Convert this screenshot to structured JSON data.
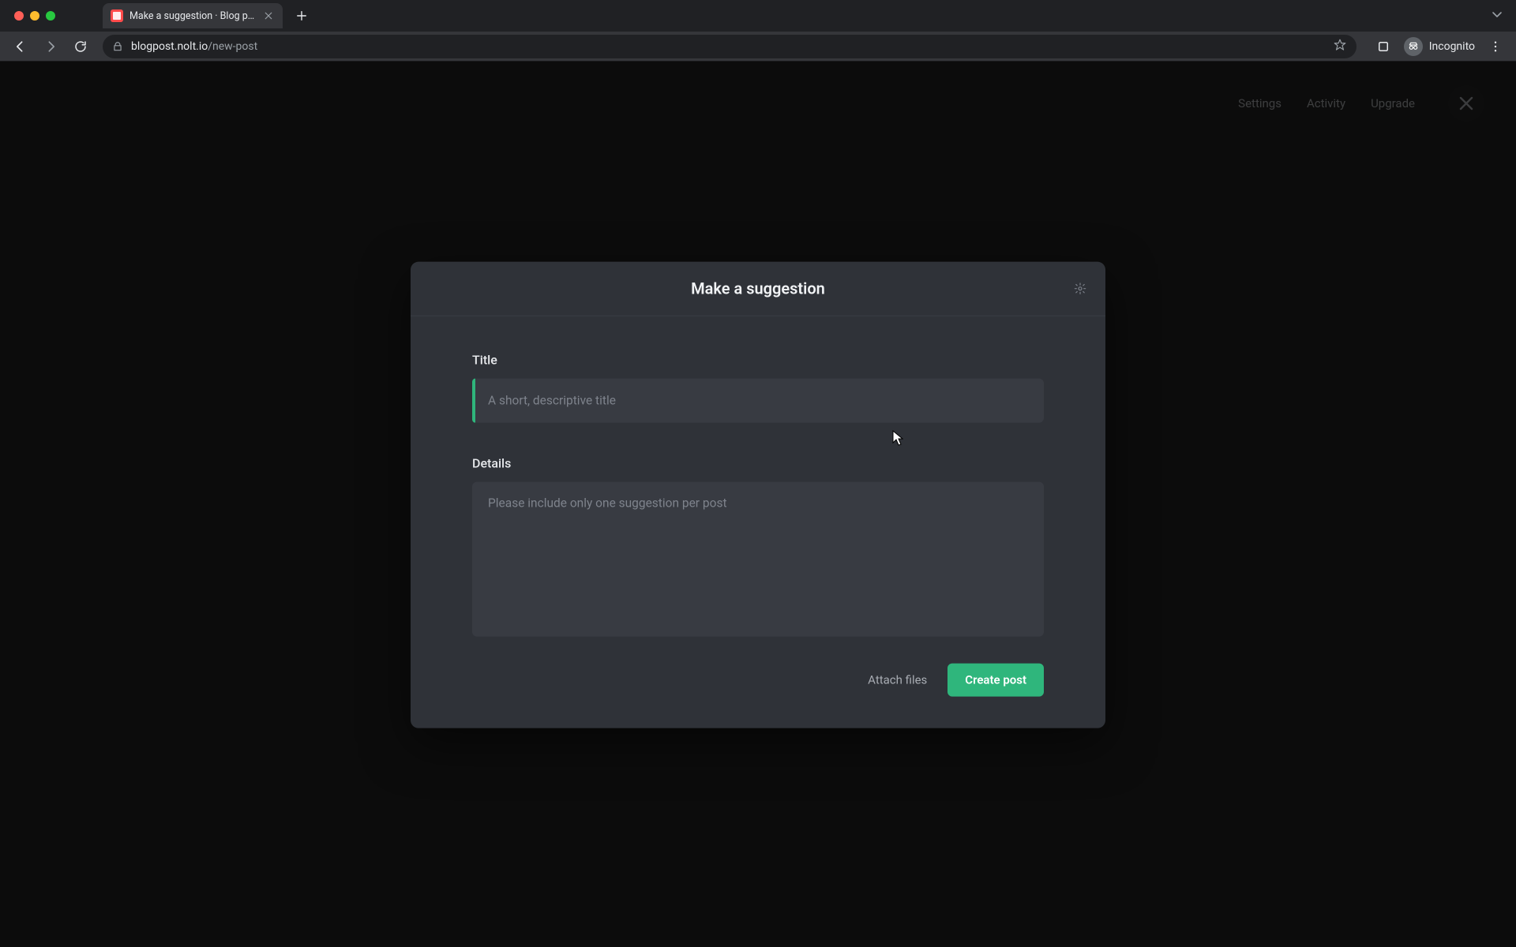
{
  "browser": {
    "tab_title": "Make a suggestion · Blog post",
    "url_host": "blogpost.nolt.io",
    "url_path": "/new-post",
    "incognito_label": "Incognito"
  },
  "nav": {
    "links": [
      "Settings",
      "Activity",
      "Upgrade"
    ]
  },
  "modal": {
    "title": "Make a suggestion",
    "title_label": "Title",
    "title_placeholder": "A short, descriptive title",
    "title_value": "",
    "details_label": "Details",
    "details_placeholder": "Please include only one suggestion per post",
    "details_value": "",
    "attach_label": "Attach files",
    "submit_label": "Create post"
  },
  "colors": {
    "accent": "#2fb67c",
    "modal_bg": "#2f3238",
    "input_bg": "#383b42",
    "page_bg": "#0c0c0c"
  }
}
